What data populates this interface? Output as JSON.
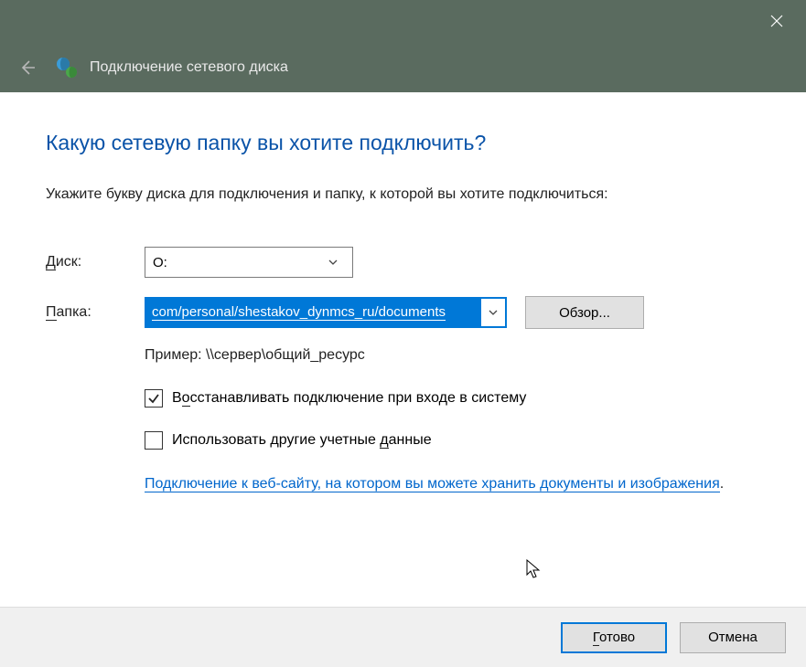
{
  "header": {
    "title": "Подключение сетевого диска"
  },
  "main": {
    "heading": "Какую сетевую папку вы хотите подключить?",
    "intro": "Укажите букву диска для подключения и папку, к которой вы хотите подключиться:",
    "drive_label_u": "Д",
    "drive_label_rest": "иск:",
    "drive_value": "O:",
    "folder_label_u": "П",
    "folder_label_rest": "апка:",
    "folder_value": "com/personal/shestakov_dynmcs_ru/documents",
    "browse_button": "Обзор...",
    "example": "Пример: \\\\сервер\\общий_ресурс",
    "reconnect_pre": "В",
    "reconnect_u": "о",
    "reconnect_post": "сстанавливать подключение при входе в систему",
    "reconnect_value": true,
    "creds_pre": "Использовать другие учетные ",
    "creds_u": "д",
    "creds_post": "анные",
    "creds_value": false,
    "website_link": "Подключение к веб-сайту, на котором вы можете хранить документы и изображения",
    "website_dot": "."
  },
  "footer": {
    "finish_u": "Г",
    "finish_rest": "отово",
    "cancel": "Отмена"
  }
}
